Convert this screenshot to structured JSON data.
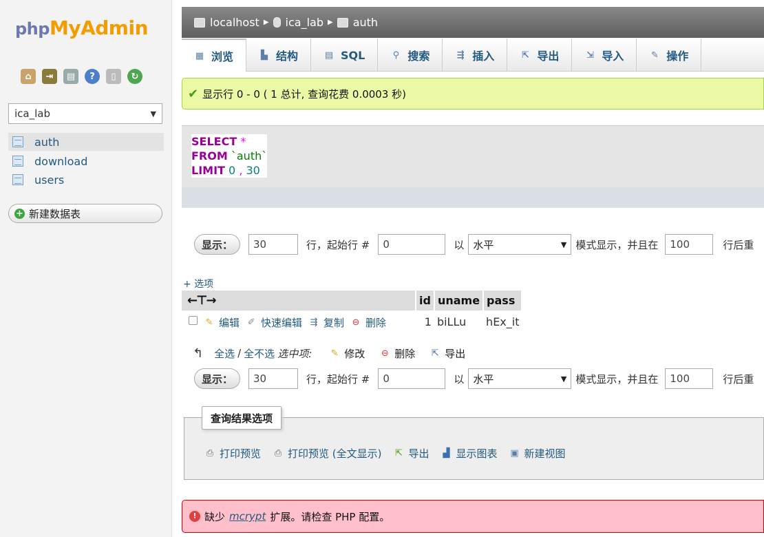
{
  "logo": {
    "php": "php",
    "my": "My",
    "admin": "Admin"
  },
  "sidebar": {
    "nav_icons": [
      "home-icon",
      "logout-icon",
      "sql-query-icon",
      "help-icon",
      "docs-icon",
      "reload-icon"
    ],
    "db_select": "ica_lab",
    "tables": [
      {
        "label": "auth",
        "active": true
      },
      {
        "label": "download",
        "active": false
      },
      {
        "label": "users",
        "active": false
      }
    ],
    "new_table": "新建数据表"
  },
  "breadcrumb": {
    "server": "localhost",
    "database": "ica_lab",
    "table": "auth"
  },
  "tabs": [
    {
      "label": "浏览",
      "icon": "browse-icon",
      "active": true
    },
    {
      "label": "结构",
      "icon": "structure-icon"
    },
    {
      "label": "SQL",
      "icon": "sql-icon"
    },
    {
      "label": "搜索",
      "icon": "search-icon"
    },
    {
      "label": "插入",
      "icon": "insert-icon"
    },
    {
      "label": "导出",
      "icon": "export-icon"
    },
    {
      "label": "导入",
      "icon": "import-icon"
    },
    {
      "label": "操作",
      "icon": "operations-icon"
    }
  ],
  "success_message": "显示行 0 - 0 ( 1 总计, 查询花费 0.0003 秒)",
  "sql": {
    "select": "SELECT",
    "star": "*",
    "from": "FROM",
    "table": "`auth`",
    "limit": "LIMIT",
    "offset": "0",
    "comma": ",",
    "count": "30"
  },
  "nav": {
    "show_button": "显示：",
    "rows": "30",
    "rows_label": "行，起始行 #",
    "start": "0",
    "with_label": "以",
    "mode": "水平",
    "mode_label": "模式显示，并且在",
    "repeat": "100",
    "repeat_label": "行后重"
  },
  "options_link": "+ 选项",
  "table": {
    "headers": [
      "id",
      "uname",
      "pass"
    ],
    "actions": {
      "edit": "编辑",
      "quick_edit": "快速编辑",
      "copy": "复制",
      "delete": "删除"
    },
    "rows": [
      {
        "id": "1",
        "uname": "biLLu",
        "pass": "hEx_it"
      }
    ]
  },
  "bulk": {
    "check_all": "全选",
    "slash": "/",
    "uncheck_all": "全不选",
    "with_selected": "选中项:",
    "change": "修改",
    "delete": "删除",
    "export": "导出"
  },
  "query_results": {
    "legend": "查询结果选项",
    "print": "打印预览",
    "print_full": "打印预览 (全文显示)",
    "export": "导出",
    "chart": "显示图表",
    "create_view": "新建视图"
  },
  "error": {
    "prefix": "缺少",
    "ext": "mcrypt",
    "suffix": "扩展。请检查 PHP 配置。"
  }
}
